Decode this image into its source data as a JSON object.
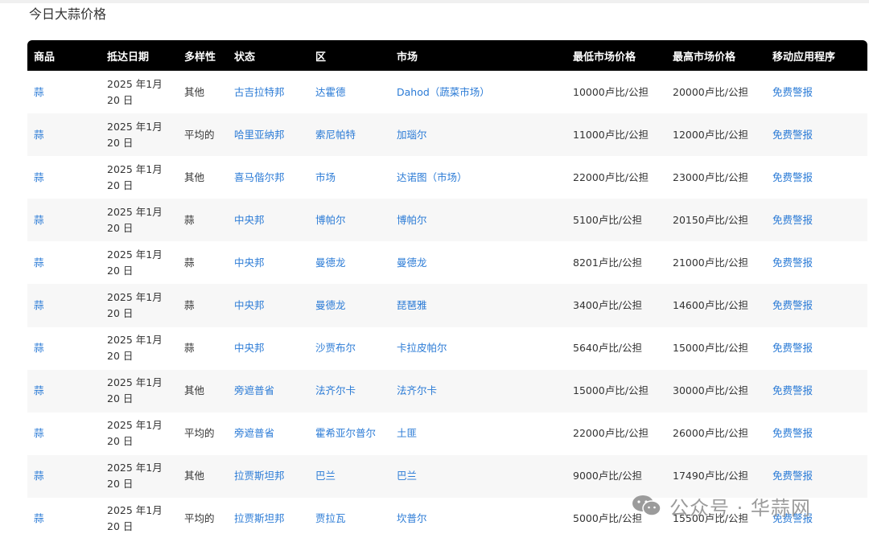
{
  "page_title": "今日大蒜价格",
  "columns": [
    "商品",
    "抵达日期",
    "多样性",
    "状态",
    "区",
    "市场",
    "最低市场价格",
    "最高市场价格",
    "移动应用程序"
  ],
  "rows": [
    {
      "commodity": "蒜",
      "date": "2025 年1月 20 日",
      "variety": "其他",
      "state": "古吉拉特邦",
      "district": "达霍德",
      "market": "Dahod（蔬菜市场）",
      "min_price": "10000卢比/公担",
      "max_price": "20000卢比/公担",
      "app": "免费警报"
    },
    {
      "commodity": "蒜",
      "date": "2025 年1月 20 日",
      "variety": "平均的",
      "state": "哈里亚纳邦",
      "district": "索尼帕特",
      "market": "加瑙尔",
      "min_price": "11000卢比/公担",
      "max_price": "12000卢比/公担",
      "app": "免费警报"
    },
    {
      "commodity": "蒜",
      "date": "2025 年1月 20 日",
      "variety": "其他",
      "state": "喜马偕尔邦",
      "district": "市场",
      "market": "达诺图（市场）",
      "min_price": "22000卢比/公担",
      "max_price": "23000卢比/公担",
      "app": "免费警报"
    },
    {
      "commodity": "蒜",
      "date": "2025 年1月 20 日",
      "variety": "蒜",
      "state": "中央邦",
      "district": "博帕尔",
      "market": "博帕尔",
      "min_price": "5100卢比/公担",
      "max_price": "20150卢比/公担",
      "app": "免费警报"
    },
    {
      "commodity": "蒜",
      "date": "2025 年1月 20 日",
      "variety": "蒜",
      "state": "中央邦",
      "district": "曼德龙",
      "market": "曼德龙",
      "min_price": "8201卢比/公担",
      "max_price": "21000卢比/公担",
      "app": "免费警报"
    },
    {
      "commodity": "蒜",
      "date": "2025 年1月 20 日",
      "variety": "蒜",
      "state": "中央邦",
      "district": "曼德龙",
      "market": "琵琶雅",
      "min_price": "3400卢比/公担",
      "max_price": "14600卢比/公担",
      "app": "免费警报"
    },
    {
      "commodity": "蒜",
      "date": "2025 年1月 20 日",
      "variety": "蒜",
      "state": "中央邦",
      "district": "沙贾布尔",
      "market": "卡拉皮帕尔",
      "min_price": "5640卢比/公担",
      "max_price": "15000卢比/公担",
      "app": "免费警报"
    },
    {
      "commodity": "蒜",
      "date": "2025 年1月 20 日",
      "variety": "其他",
      "state": "旁遮普省",
      "district": "法齐尔卡",
      "market": "法齐尔卡",
      "min_price": "15000卢比/公担",
      "max_price": "30000卢比/公担",
      "app": "免费警报"
    },
    {
      "commodity": "蒜",
      "date": "2025 年1月 20 日",
      "variety": "平均的",
      "state": "旁遮普省",
      "district": "霍希亚尔普尔",
      "market": "土匪",
      "min_price": "22000卢比/公担",
      "max_price": "26000卢比/公担",
      "app": "免费警报"
    },
    {
      "commodity": "蒜",
      "date": "2025 年1月 20 日",
      "variety": "其他",
      "state": "拉贾斯坦邦",
      "district": "巴兰",
      "market": "巴兰",
      "min_price": "9000卢比/公担",
      "max_price": "17490卢比/公担",
      "app": "免费警报"
    },
    {
      "commodity": "蒜",
      "date": "2025 年1月 20 日",
      "variety": "平均的",
      "state": "拉贾斯坦邦",
      "district": "贾拉瓦",
      "market": "坎普尔",
      "min_price": "5000卢比/公担",
      "max_price": "15500卢比/公担",
      "app": "免费警报"
    }
  ],
  "watermark": {
    "icon": "wechat-icon",
    "text": "公众号 · 华蒜网"
  },
  "colors": {
    "header_bg": "#000000",
    "link": "#2b7bd6",
    "stripe": "#f7f7f7"
  }
}
